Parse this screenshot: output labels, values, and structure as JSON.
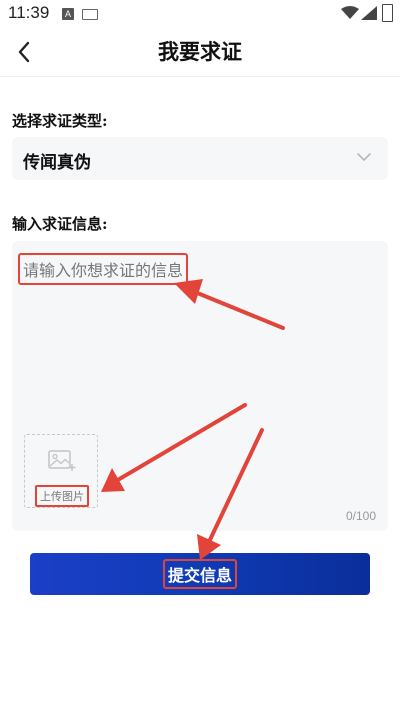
{
  "status_bar": {
    "time": "11:39",
    "notification_letter": "A"
  },
  "header": {
    "title": "我要求证",
    "back_icon": "chevron-left-icon"
  },
  "form": {
    "type_label": "选择求证类型:",
    "type_value": "传闻真伪",
    "info_label": "输入求证信息:",
    "info_placeholder": "请输入你想求证的信息",
    "upload_label": "上传图片",
    "counter": "0/100"
  },
  "submit": {
    "label": "提交信息",
    "colors": [
      "#1b3fc7",
      "#0b2e9a"
    ]
  },
  "annotation_color": "#e2443a"
}
